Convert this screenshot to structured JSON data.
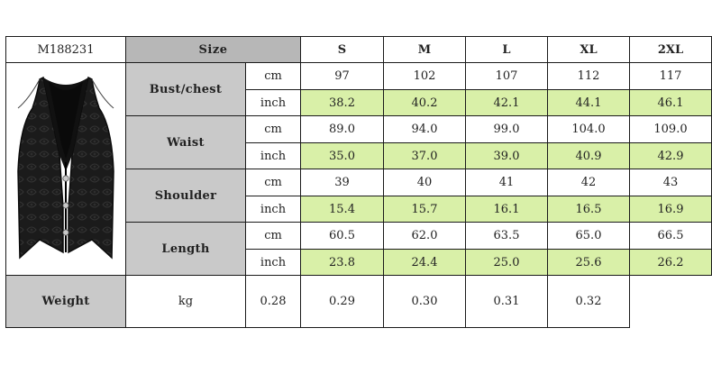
{
  "product_code": "M188231",
  "size_header": "Size",
  "sizes": [
    "S",
    "M",
    "L",
    "XL",
    "2XL"
  ],
  "rows": [
    {
      "measure": "Bust/chest",
      "cm_unit": "cm",
      "cm": [
        "97",
        "102",
        "107",
        "112",
        "117"
      ],
      "inch_unit": "inch",
      "inch": [
        "38.2",
        "40.2",
        "42.1",
        "44.1",
        "46.1"
      ]
    },
    {
      "measure": "Waist",
      "cm_unit": "cm",
      "cm": [
        "89.0",
        "94.0",
        "99.0",
        "104.0",
        "109.0"
      ],
      "inch_unit": "inch",
      "inch": [
        "35.0",
        "37.0",
        "39.0",
        "40.9",
        "42.9"
      ]
    },
    {
      "measure": "Shoulder",
      "cm_unit": "cm",
      "cm": [
        "39",
        "40",
        "41",
        "42",
        "43"
      ],
      "inch_unit": "inch",
      "inch": [
        "15.4",
        "15.7",
        "16.1",
        "16.5",
        "16.9"
      ]
    },
    {
      "measure": "Length",
      "cm_unit": "cm",
      "cm": [
        "60.5",
        "62.0",
        "63.5",
        "65.0",
        "66.5"
      ],
      "inch_unit": "inch",
      "inch": [
        "23.8",
        "24.4",
        "25.0",
        "25.6",
        "26.2"
      ]
    }
  ],
  "weight": {
    "measure": "Weight",
    "unit": "kg",
    "values": [
      "0.28",
      "0.29",
      "0.30",
      "0.31",
      "0.32"
    ]
  },
  "colors": {
    "header_gray": "#b7b7b7",
    "label_gray": "#c9c9c9",
    "inch_green": "#d9f0a8",
    "border": "#1a1a1a"
  }
}
